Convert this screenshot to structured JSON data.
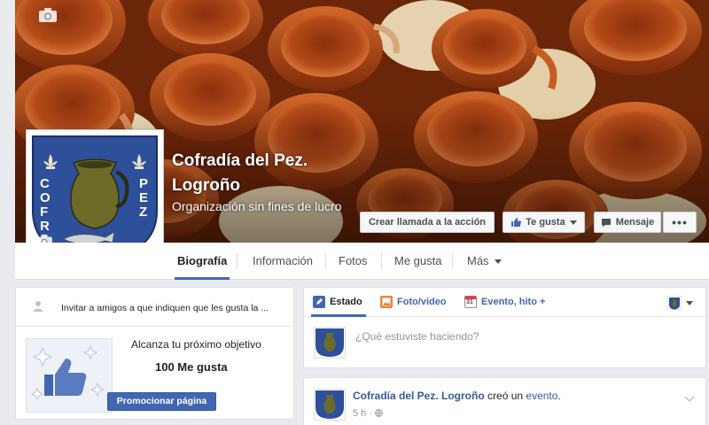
{
  "page": {
    "name": "Cofradía del Pez. Logroño",
    "category": "Organización sin fines de lucro"
  },
  "actions": {
    "cta_label": "Crear llamada a la acción",
    "like_label": "Te gusta",
    "message_label": "Mensaje",
    "more_label": "•••"
  },
  "nav": {
    "tabs": [
      {
        "label": "Biografía",
        "active": true
      },
      {
        "label": "Información"
      },
      {
        "label": "Fotos"
      },
      {
        "label": "Me gusta"
      },
      {
        "label": "Más"
      }
    ]
  },
  "sidebar": {
    "invite_text": "Invitar a amigos a que indiquen que les gusta la ...",
    "goal_title": "Alcanza tu próximo objetivo",
    "goal_value": "100 Me gusta",
    "promote_label": "Promocionar página"
  },
  "composer": {
    "tabs": [
      {
        "label": "Estado",
        "active": true
      },
      {
        "label": "Foto/video"
      },
      {
        "label": "Evento, hito +"
      }
    ],
    "calendar_day": "31",
    "placeholder": "¿Qué estuviste haciendo?"
  },
  "post": {
    "author": "Cofradía del Pez. Logroño",
    "action_text": "creó un",
    "action_link": "evento",
    "action_end": ".",
    "time": "5 h ·"
  },
  "colors": {
    "facebook_blue": "#4267b2",
    "link_blue": "#365899",
    "crest_blue": "#2e4f9a",
    "cover_terracotta": "#b5531f"
  }
}
